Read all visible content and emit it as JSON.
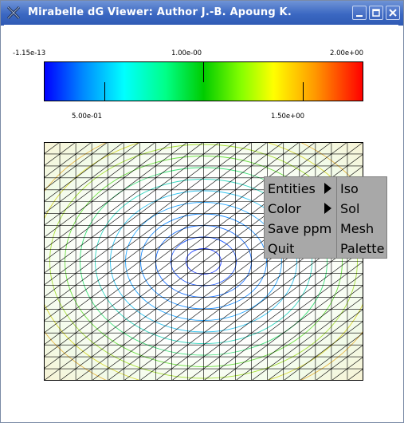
{
  "window": {
    "title": "Mirabelle dG Viewer:  Author J.-B. Apoung K.",
    "buttons": [
      "minimize",
      "maximize",
      "close"
    ]
  },
  "colorbar": {
    "top_labels": {
      "min": "-1.15e-13",
      "mid": "1.00e-00",
      "max": "2.00e+00"
    },
    "bottom_labels": {
      "left": "5.00e-01",
      "right": "1.50e+00"
    },
    "colors": [
      "#0000ff",
      "#00ffff",
      "#00cc00",
      "#ffff00",
      "#ff0000"
    ]
  },
  "plot": {
    "mesh": "triangular grid 20 x 20",
    "display": [
      "iso contours",
      "mesh"
    ]
  },
  "context_menu": {
    "items": [
      "Entities",
      "Color",
      "Save ppm",
      "Quit"
    ],
    "submenu_items": [
      "Iso",
      "Sol",
      "Mesh",
      "Palette"
    ],
    "has_submenu": [
      "Entities",
      "Color"
    ]
  },
  "colors": {
    "titlebar": "#3a67c2",
    "menu_bg": "#a8a8a8"
  }
}
